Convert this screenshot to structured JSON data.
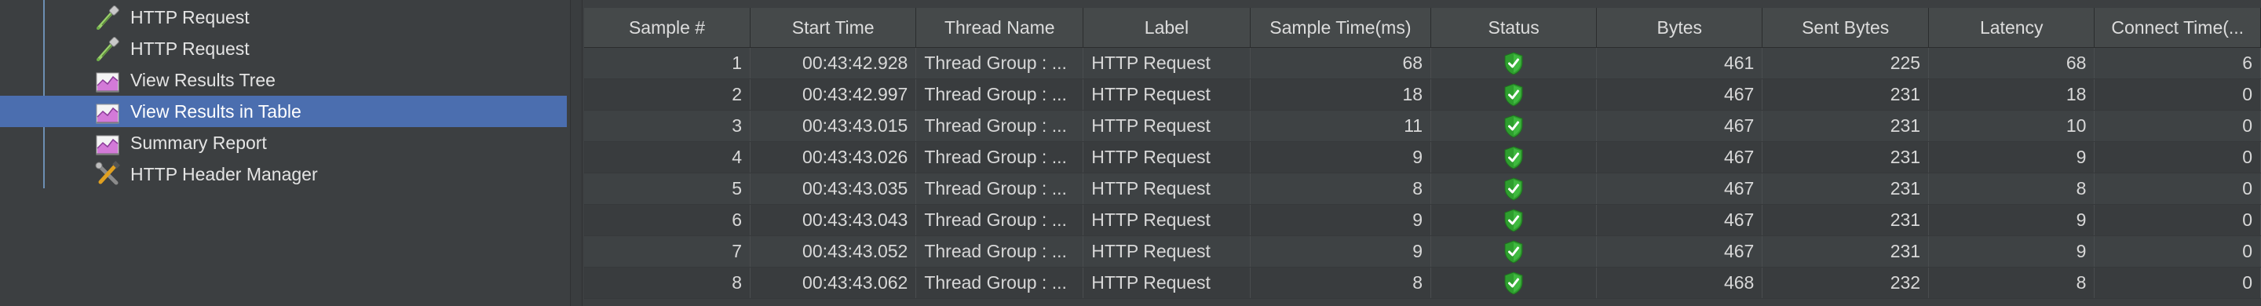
{
  "tree": {
    "items": [
      {
        "label": "HTTP Request",
        "icon": "http-request-icon"
      },
      {
        "label": "HTTP Request",
        "icon": "http-request-icon"
      },
      {
        "label": "View Results Tree",
        "icon": "view-results-tree-icon"
      },
      {
        "label": "View Results in Table",
        "icon": "view-results-table-icon",
        "selected": true
      },
      {
        "label": "Summary Report",
        "icon": "summary-report-icon"
      },
      {
        "label": "HTTP Header Manager",
        "icon": "header-manager-icon"
      }
    ]
  },
  "table": {
    "columns": [
      "Sample #",
      "Start Time",
      "Thread Name",
      "Label",
      "Sample Time(ms)",
      "Status",
      "Bytes",
      "Sent Bytes",
      "Latency",
      "Connect Time(..."
    ],
    "rows": [
      {
        "sample": "1",
        "start": "00:43:42.928",
        "thread": "Thread Group : ...",
        "label": "HTTP Request",
        "time": "68",
        "status": "success",
        "bytes": "461",
        "sent": "225",
        "latency": "68",
        "connect": "6"
      },
      {
        "sample": "2",
        "start": "00:43:42.997",
        "thread": "Thread Group : ...",
        "label": "HTTP Request",
        "time": "18",
        "status": "success",
        "bytes": "467",
        "sent": "231",
        "latency": "18",
        "connect": "0"
      },
      {
        "sample": "3",
        "start": "00:43:43.015",
        "thread": "Thread Group : ...",
        "label": "HTTP Request",
        "time": "11",
        "status": "success",
        "bytes": "467",
        "sent": "231",
        "latency": "10",
        "connect": "0"
      },
      {
        "sample": "4",
        "start": "00:43:43.026",
        "thread": "Thread Group : ...",
        "label": "HTTP Request",
        "time": "9",
        "status": "success",
        "bytes": "467",
        "sent": "231",
        "latency": "9",
        "connect": "0"
      },
      {
        "sample": "5",
        "start": "00:43:43.035",
        "thread": "Thread Group : ...",
        "label": "HTTP Request",
        "time": "8",
        "status": "success",
        "bytes": "467",
        "sent": "231",
        "latency": "8",
        "connect": "0"
      },
      {
        "sample": "6",
        "start": "00:43:43.043",
        "thread": "Thread Group : ...",
        "label": "HTTP Request",
        "time": "9",
        "status": "success",
        "bytes": "467",
        "sent": "231",
        "latency": "9",
        "connect": "0"
      },
      {
        "sample": "7",
        "start": "00:43:43.052",
        "thread": "Thread Group : ...",
        "label": "HTTP Request",
        "time": "9",
        "status": "success",
        "bytes": "467",
        "sent": "231",
        "latency": "9",
        "connect": "0"
      },
      {
        "sample": "8",
        "start": "00:43:43.062",
        "thread": "Thread Group : ...",
        "label": "HTTP Request",
        "time": "8",
        "status": "success",
        "bytes": "468",
        "sent": "232",
        "latency": "8",
        "connect": "0"
      }
    ]
  },
  "colors": {
    "selection": "#4b6eaf",
    "status_success": "#3ec23e"
  }
}
